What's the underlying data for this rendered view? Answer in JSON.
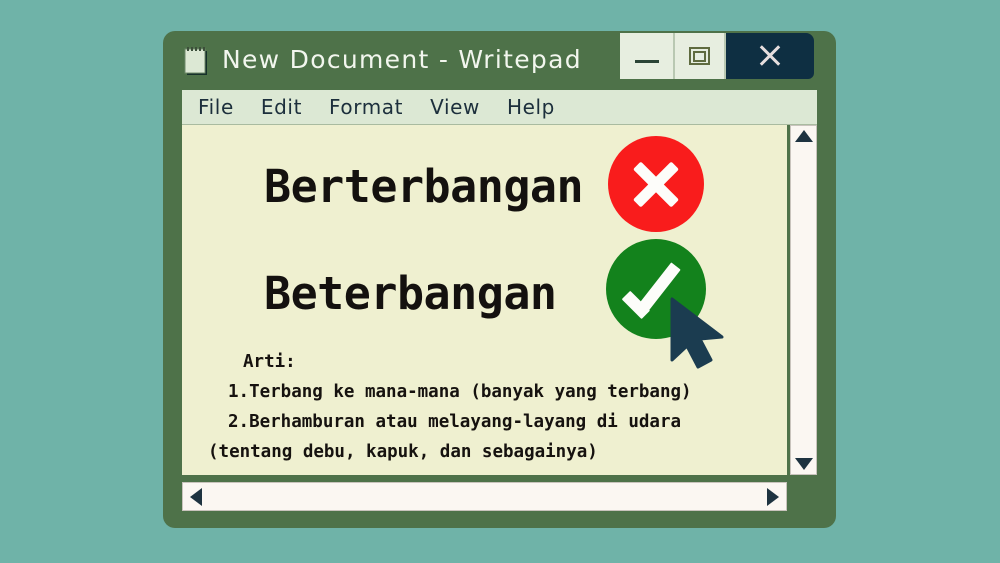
{
  "desktop": {
    "background_color": "#6fb3a8"
  },
  "window": {
    "frame_color": "#4e7249",
    "title": "New Document - Writepad",
    "app_icon": "notepad-icon",
    "controls": {
      "minimize_label": "—",
      "minimize_icon": "minimize-icon",
      "maximize_label": "▣",
      "maximize_icon": "maximize-icon",
      "close_label": "✕",
      "close_icon": "close-icon",
      "close_bg_color": "#0e2f42"
    }
  },
  "menu": {
    "background_color": "#dce8d4",
    "items": [
      {
        "label": "File"
      },
      {
        "label": "Edit"
      },
      {
        "label": "Format"
      },
      {
        "label": "View"
      },
      {
        "label": "Help"
      }
    ]
  },
  "document": {
    "background_color": "#eff0d0",
    "incorrect_word": "Berterbangan",
    "correct_word": "Beterbangan",
    "incorrect_mark": {
      "icon": "red-cross-circle-icon",
      "color": "#f91c1c",
      "glyph": "✕"
    },
    "correct_mark": {
      "icon": "green-check-circle-icon",
      "color": "#13821c",
      "glyph": "✓"
    },
    "cursor": {
      "icon": "mouse-pointer-icon",
      "color": "#1b3c50"
    },
    "definition": {
      "label": "Arti:",
      "items": [
        "1.Terbang ke mana-mana (banyak yang terbang)",
        "2.Berhamburan atau melayang-layang di udara"
      ],
      "note": "(tentang debu, kapuk, dan sebagainya)"
    }
  },
  "scrollbars": {
    "track_color": "#fbf7f2",
    "arrow_color": "#1e3340",
    "vertical": {
      "up_icon": "scroll-up-arrow-icon",
      "down_icon": "scroll-down-arrow-icon"
    },
    "horizontal": {
      "left_icon": "scroll-left-arrow-icon",
      "right_icon": "scroll-right-arrow-icon"
    }
  }
}
